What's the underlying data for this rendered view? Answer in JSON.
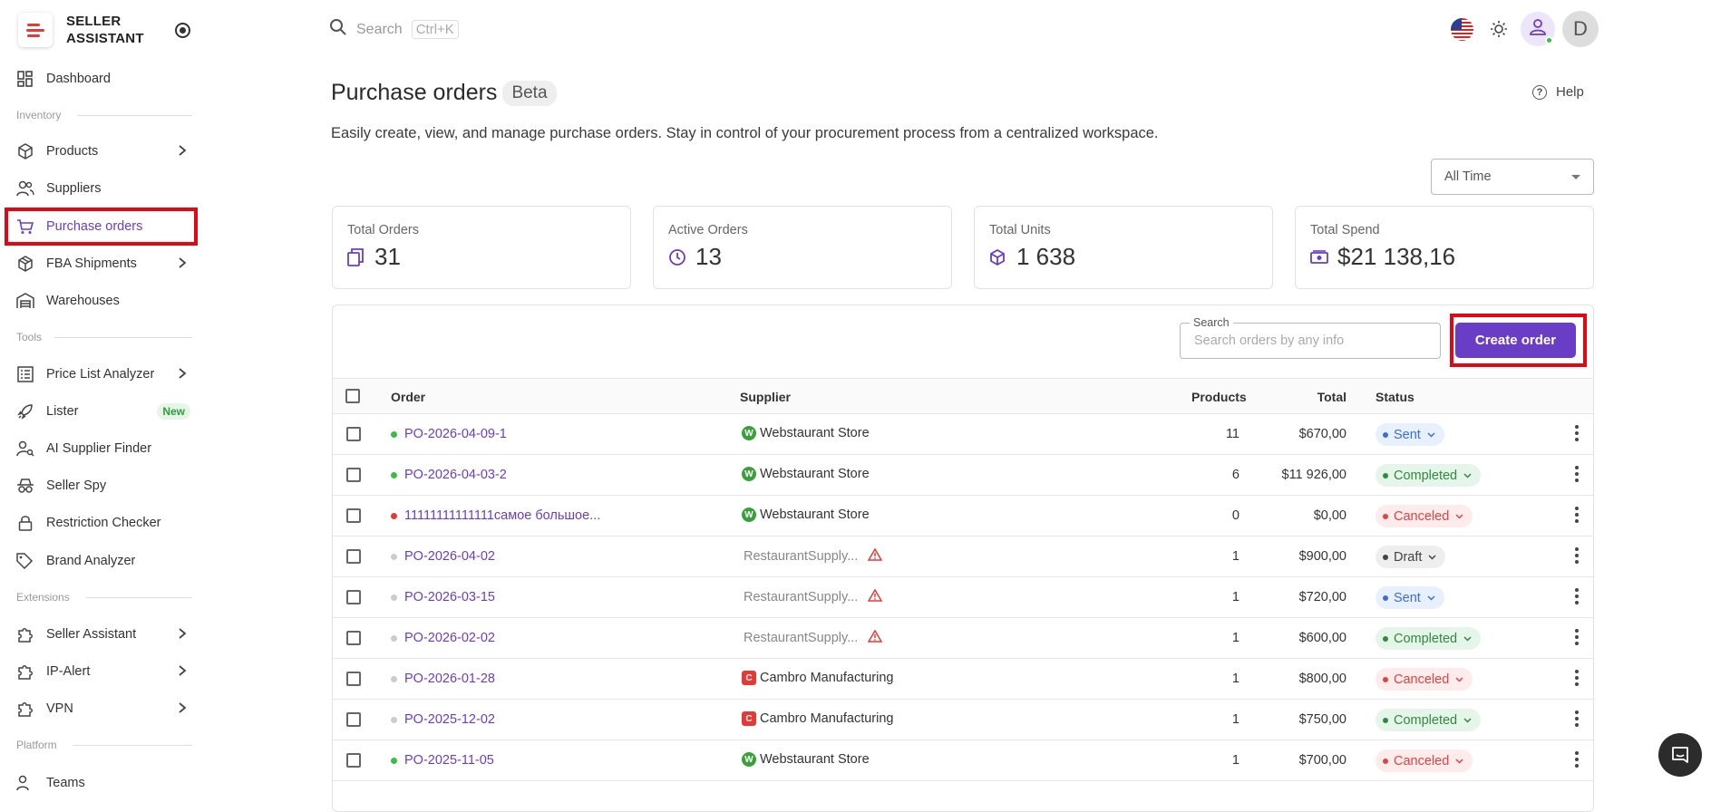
{
  "brand": {
    "line1": "SELLER",
    "line2": "ASSISTANT"
  },
  "sidebar": {
    "dashboard": "Dashboard",
    "section_inventory": "Inventory",
    "products": "Products",
    "suppliers": "Suppliers",
    "purchase_orders": "Purchase orders",
    "fba_shipments": "FBA Shipments",
    "warehouses": "Warehouses",
    "section_tools": "Tools",
    "price_list_analyzer": "Price List Analyzer",
    "lister": "Lister",
    "lister_badge": "New",
    "ai_supplier_finder": "AI Supplier Finder",
    "seller_spy": "Seller Spy",
    "restriction_checker": "Restriction Checker",
    "brand_analyzer": "Brand Analyzer",
    "section_extensions": "Extensions",
    "seller_assistant": "Seller Assistant",
    "ip_alert": "IP-Alert",
    "vpn": "VPN",
    "section_platform": "Platform",
    "teams": "Teams"
  },
  "topbar": {
    "search_placeholder": "Search",
    "search_shortcut": "Ctrl+K",
    "avatar_letter": "D"
  },
  "header": {
    "title": "Purchase orders",
    "badge": "Beta",
    "help": "Help",
    "subtitle": "Easily create, view, and manage purchase orders. Stay in control of your procurement process from a centralized workspace.",
    "period": "All Time"
  },
  "stats": {
    "total_orders": {
      "label": "Total Orders",
      "value": "31"
    },
    "active_orders": {
      "label": "Active Orders",
      "value": "13"
    },
    "total_units": {
      "label": "Total Units",
      "value": "1 638"
    },
    "total_spend": {
      "label": "Total Spend",
      "value": "$21 138,16"
    }
  },
  "table": {
    "search_label": "Search",
    "search_placeholder": "Search orders by any info",
    "create_button": "Create order",
    "columns": {
      "order": "Order",
      "supplier": "Supplier",
      "products": "Products",
      "total": "Total",
      "status": "Status"
    },
    "rows": [
      {
        "order": "PO-2026-04-09-1",
        "supplier": "Webstaurant Store",
        "products": "11",
        "total": "$670,00",
        "status": "Sent"
      },
      {
        "order": "PO-2026-04-03-2",
        "supplier": "Webstaurant Store",
        "products": "6",
        "total": "$11 926,00",
        "status": "Completed"
      },
      {
        "order": "11111111111111самое большое...",
        "supplier": "Webstaurant Store",
        "products": "0",
        "total": "$0,00",
        "status": "Canceled"
      },
      {
        "order": "PO-2026-04-02",
        "supplier": "RestaurantSupply...",
        "products": "1",
        "total": "$900,00",
        "status": "Draft"
      },
      {
        "order": "PO-2026-03-15",
        "supplier": "RestaurantSupply...",
        "products": "1",
        "total": "$720,00",
        "status": "Sent"
      },
      {
        "order": "PO-2026-02-02",
        "supplier": "RestaurantSupply...",
        "products": "1",
        "total": "$600,00",
        "status": "Completed"
      },
      {
        "order": "PO-2026-01-28",
        "supplier": "Cambro Manufacturing",
        "products": "1",
        "total": "$800,00",
        "status": "Canceled"
      },
      {
        "order": "PO-2025-12-02",
        "supplier": "Cambro Manufacturing",
        "products": "1",
        "total": "$750,00",
        "status": "Completed"
      },
      {
        "order": "PO-2025-11-05",
        "supplier": "Webstaurant Store",
        "products": "1",
        "total": "$700,00",
        "status": "Canceled"
      }
    ]
  },
  "colors": {
    "accent": "#6a3dc7",
    "highlight": "#e30613",
    "green": "#35c13f",
    "red": "#e53935"
  },
  "icons": [
    "search-icon",
    "sun-icon",
    "user-icon",
    "help-icon",
    "chat-icon",
    "warning-icon",
    "chevron-right-icon",
    "kebab-icon"
  ]
}
